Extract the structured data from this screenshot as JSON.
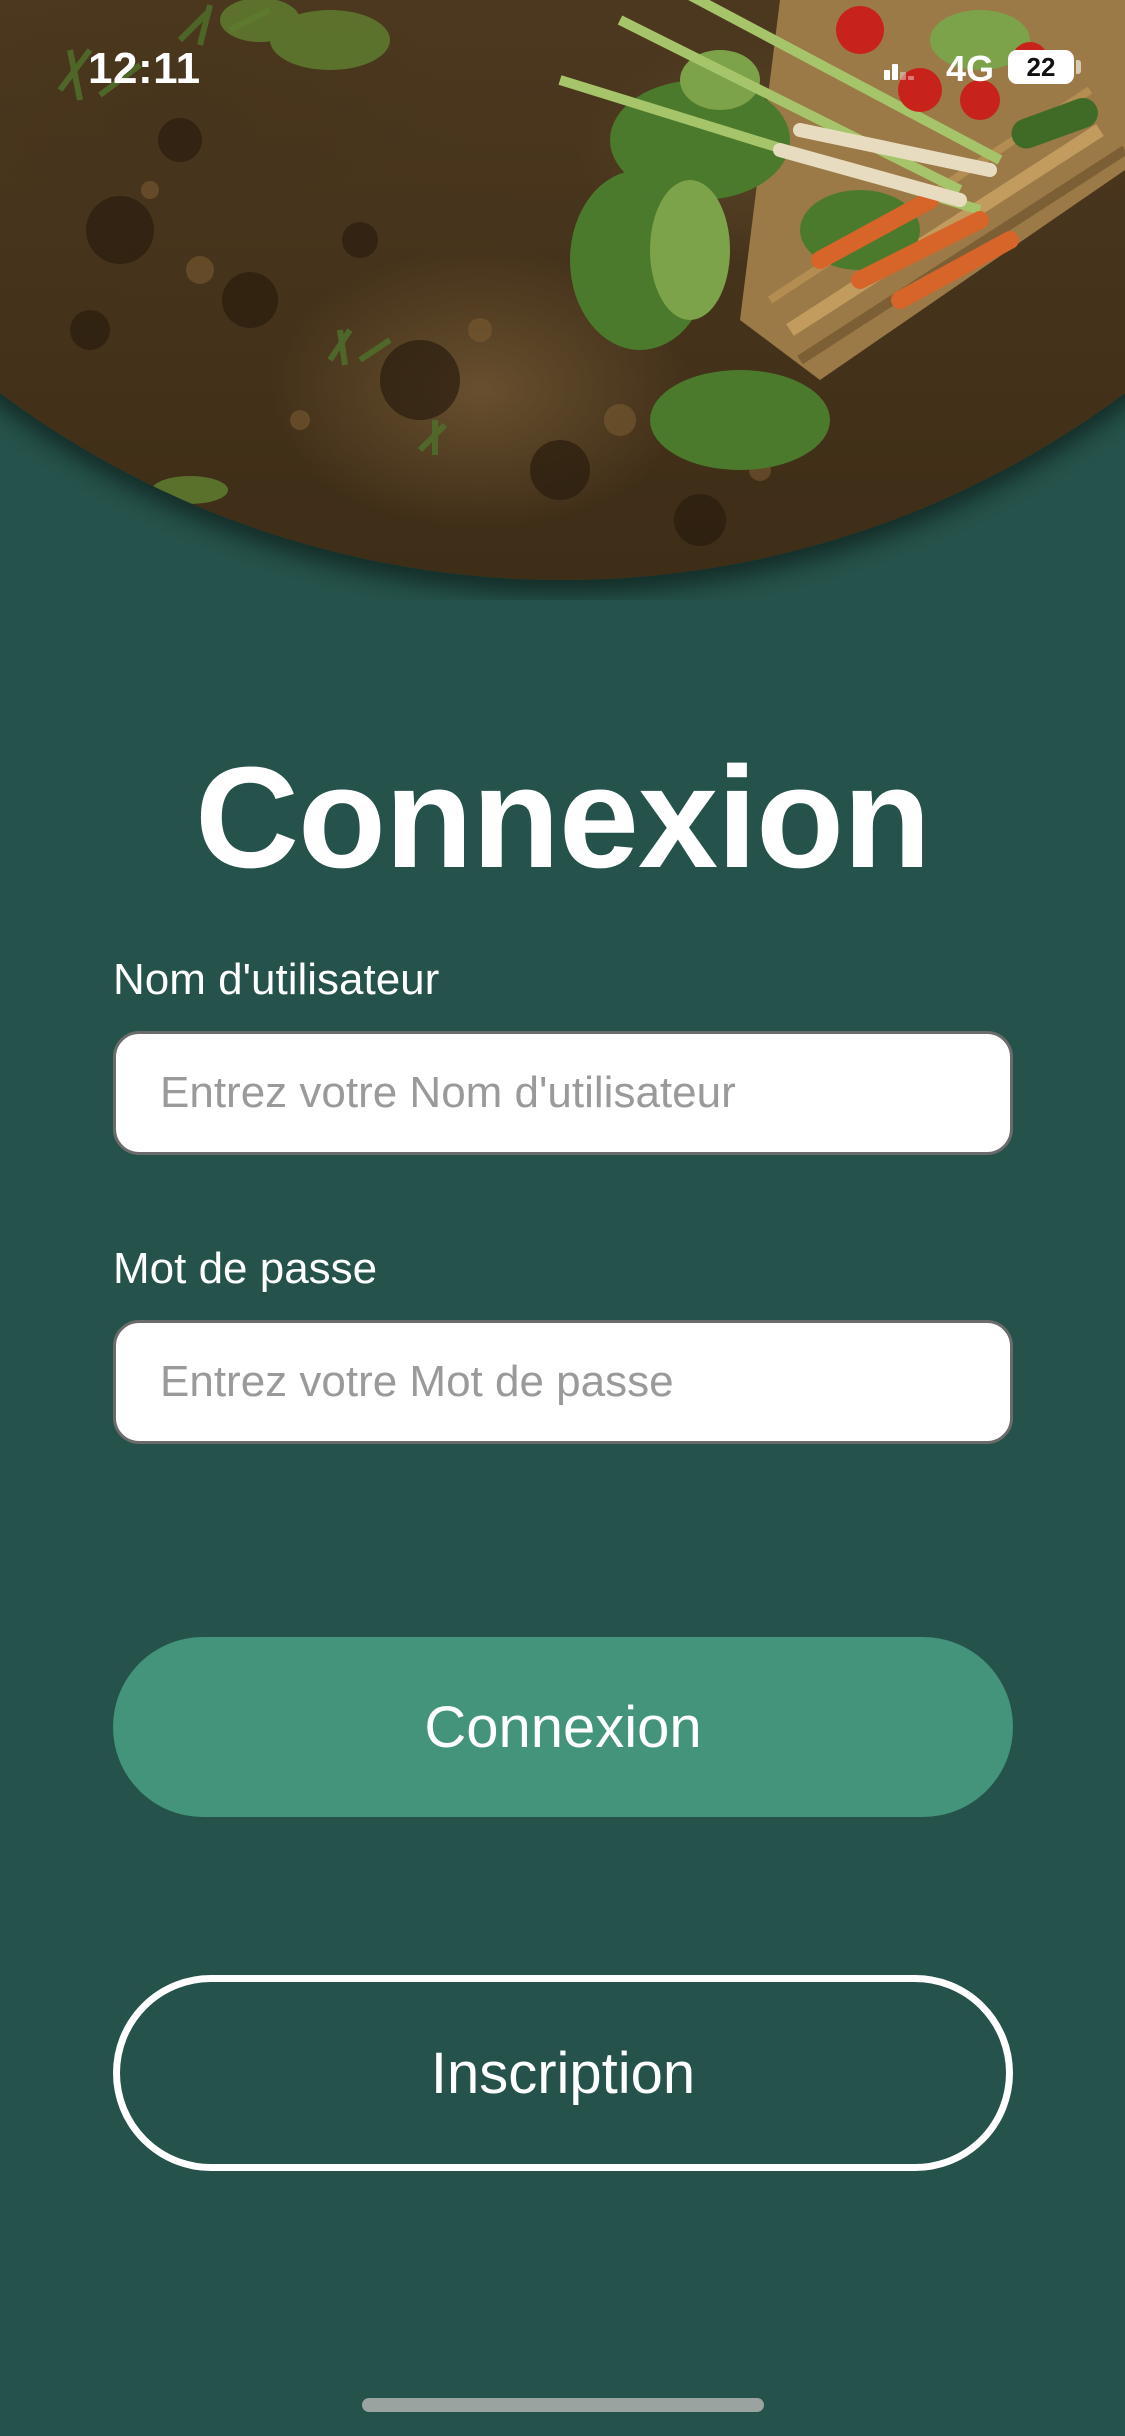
{
  "status_bar": {
    "time": "12:11",
    "network": "4G",
    "battery": "22"
  },
  "hero": {
    "icon": "vegetable-basket-photo"
  },
  "login": {
    "title": "Connexion",
    "username_label": "Nom d'utilisateur",
    "username_placeholder": "Entrez votre Nom d'utilisateur",
    "username_value": "",
    "password_label": "Mot de passe",
    "password_placeholder": "Entrez votre Mot de passe",
    "password_value": "",
    "submit_label": "Connexion",
    "register_label": "Inscription"
  },
  "colors": {
    "background": "#25524a",
    "primary_button": "#43947b",
    "text": "#ffffff"
  }
}
